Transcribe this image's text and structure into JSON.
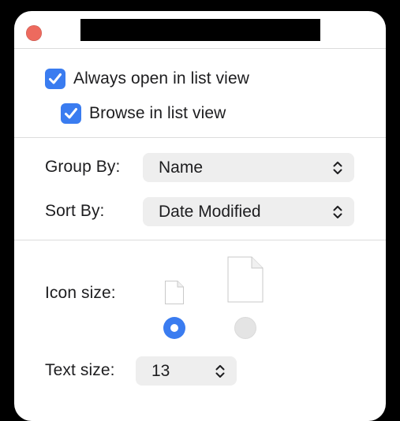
{
  "window": {
    "title": ""
  },
  "view_options": {
    "always_open_list_view": {
      "label": "Always open in list view",
      "checked": true
    },
    "browse_list_view": {
      "label": "Browse in list view",
      "checked": true
    }
  },
  "grouping": {
    "group_by": {
      "label": "Group By:",
      "value": "Name"
    },
    "sort_by": {
      "label": "Sort By:",
      "value": "Date Modified"
    }
  },
  "icon_size": {
    "label": "Icon size:",
    "options": [
      {
        "name": "small",
        "selected": true
      },
      {
        "name": "large",
        "selected": false
      }
    ]
  },
  "text_size": {
    "label": "Text size:",
    "value": "13"
  },
  "icons": {
    "close": "close-icon",
    "checkmark": "checkmark-icon",
    "chevrons": "up-down-chevron-icon",
    "document": "document-icon"
  },
  "colors": {
    "accent": "#3a7cf0",
    "close": "#ed6a5e",
    "popup_bg": "#eeeeee"
  }
}
